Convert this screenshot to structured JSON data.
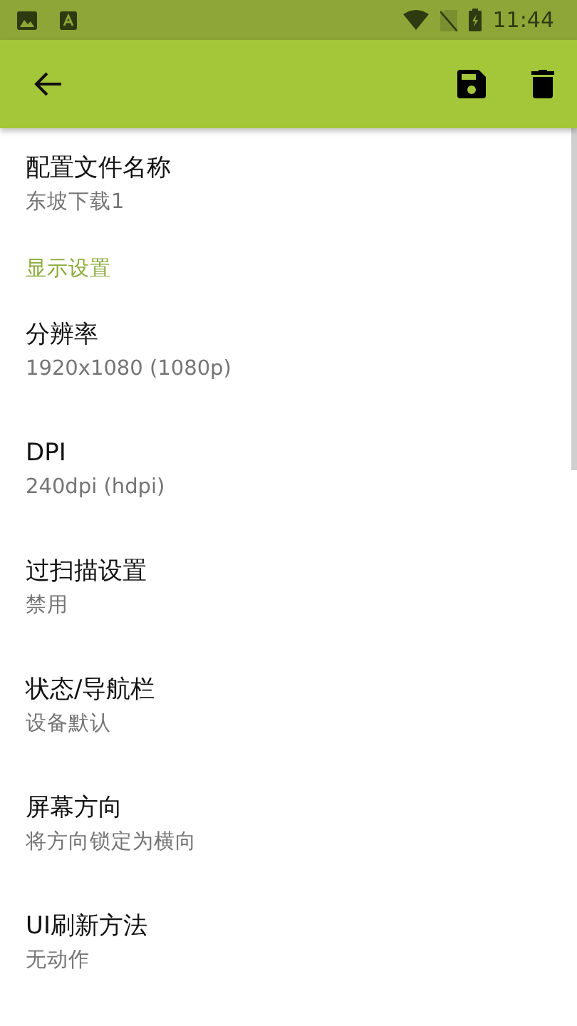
{
  "status_bar": {
    "time": "11:44"
  },
  "items": [
    {
      "kind": "setting",
      "title": "配置文件名称",
      "summary": "东坡下载1"
    },
    {
      "kind": "header",
      "title": "显示设置"
    },
    {
      "kind": "setting",
      "title": "分辨率",
      "summary": "1920x1080 (1080p)"
    },
    {
      "kind": "setting",
      "title": "DPI",
      "summary": "240dpi (hdpi)"
    },
    {
      "kind": "setting",
      "title": "过扫描设置",
      "summary": "禁用"
    },
    {
      "kind": "setting",
      "title": "状态/导航栏",
      "summary": "设备默认"
    },
    {
      "kind": "setting",
      "title": "屏幕方向",
      "summary": "将方向锁定为横向"
    },
    {
      "kind": "setting",
      "title": "UI刷新方法",
      "summary": "无动作"
    }
  ]
}
